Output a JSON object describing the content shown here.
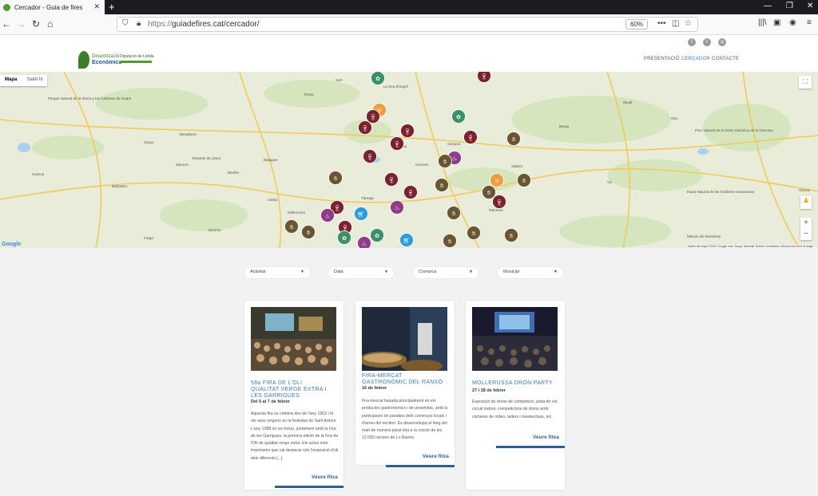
{
  "browser": {
    "tab_title": "Cercador - Guia de fires",
    "url_prefix": "https://",
    "url_main": "guiadefires.cat/cercador/",
    "zoom": "60%"
  },
  "site": {
    "logo_line1": "Dinamització",
    "logo_line2": "Econòmica",
    "logo2_title": "Diputació de Lleida",
    "menu": [
      "PRESENTACIÓ",
      "CERCADOR",
      "CONTACTE"
    ]
  },
  "map": {
    "tab_map": "Mapa",
    "tab_sat": "Satèl·lit",
    "google": "Google",
    "attribution": "Dades del mapa ©2021 Google, Inst. Geogr. Nacional    Termes i condicions    Informa d'un error al mapa",
    "place_labels": [
      "Parque Natural de la Sierra y los Cañones de Guara",
      "Barbastro",
      "Monzón",
      "Binéfar",
      "Tamarite de Litera",
      "Lleida",
      "Balaguer",
      "Tàrrega",
      "Cervera",
      "Mollerussa",
      "Solsona",
      "Manresa",
      "Vic",
      "Berga",
      "Olot",
      "Girona",
      "Huesca",
      "Fraga",
      "Alcarràs",
      "La Seu d'Urgell",
      "Tremp",
      "Sort",
      "Graus",
      "Benabarre",
      "Ripoll",
      "Parc Natural de la Zona Volcànica de la Garrotxa",
      "Espai Natural de les Guilleries-Savassona",
      "Massís del Montseny",
      "Sallent",
      "Guissona"
    ],
    "markers": [
      {
        "kind": "wine",
        "color": "#7a2230"
      },
      {
        "kind": "hand",
        "color": "#6b5634"
      },
      {
        "kind": "food",
        "color": "#8f3c8a"
      },
      {
        "kind": "cart",
        "color": "#2d9cdb"
      },
      {
        "kind": "plant",
        "color": "#3d8f6a"
      },
      {
        "kind": "cow",
        "color": "#f39c3d"
      }
    ]
  },
  "filters": [
    "Activitat",
    "Data",
    "Comarca",
    "Municipi"
  ],
  "cards": [
    {
      "title": "58a FIRA DE L'OLI QUALITAT VERGE EXTRA I LES GARRIGUES",
      "date": "Del 5 al 7 de febrer",
      "desc": "Aquesta fira se celebra des de l'any 1963 i té els seus orígens en la festivitat de Sant Antoni. L'any 1988 es va iniciar, juntament amb la Fira de les Garrigues, la primera edició de la Fira de l'Oli de qualitat verge extra. Els actes més importants que cal destacar són l'exposició d'oli dels diferents [...]",
      "more": "Veure fitxa"
    },
    {
      "title": "FIRA-MERCAT GASTRONÒMIC DEL RANXO",
      "date": "16 de febrer",
      "desc": "Fira-mercat basada principalment en els productes gastronòmics i de proximitat, amb la participació de parades dels comerços locals i d'arreu del territori. Es desenvolupa al llarg del matí de manera paral·lela a la cocció de les 12.000 racions de Lo Ranxo.",
      "more": "Veure fitxa"
    },
    {
      "title": "MOLLERUSSA DRON PARTY",
      "date": "27 i 28 de febrer",
      "desc": "Exposició de drons de competició, pista de vol, circuit indoor, competicions de drons amb càmeres de vídeo, tallers i masterclass, etc.",
      "more": "Veure fitxa"
    }
  ]
}
